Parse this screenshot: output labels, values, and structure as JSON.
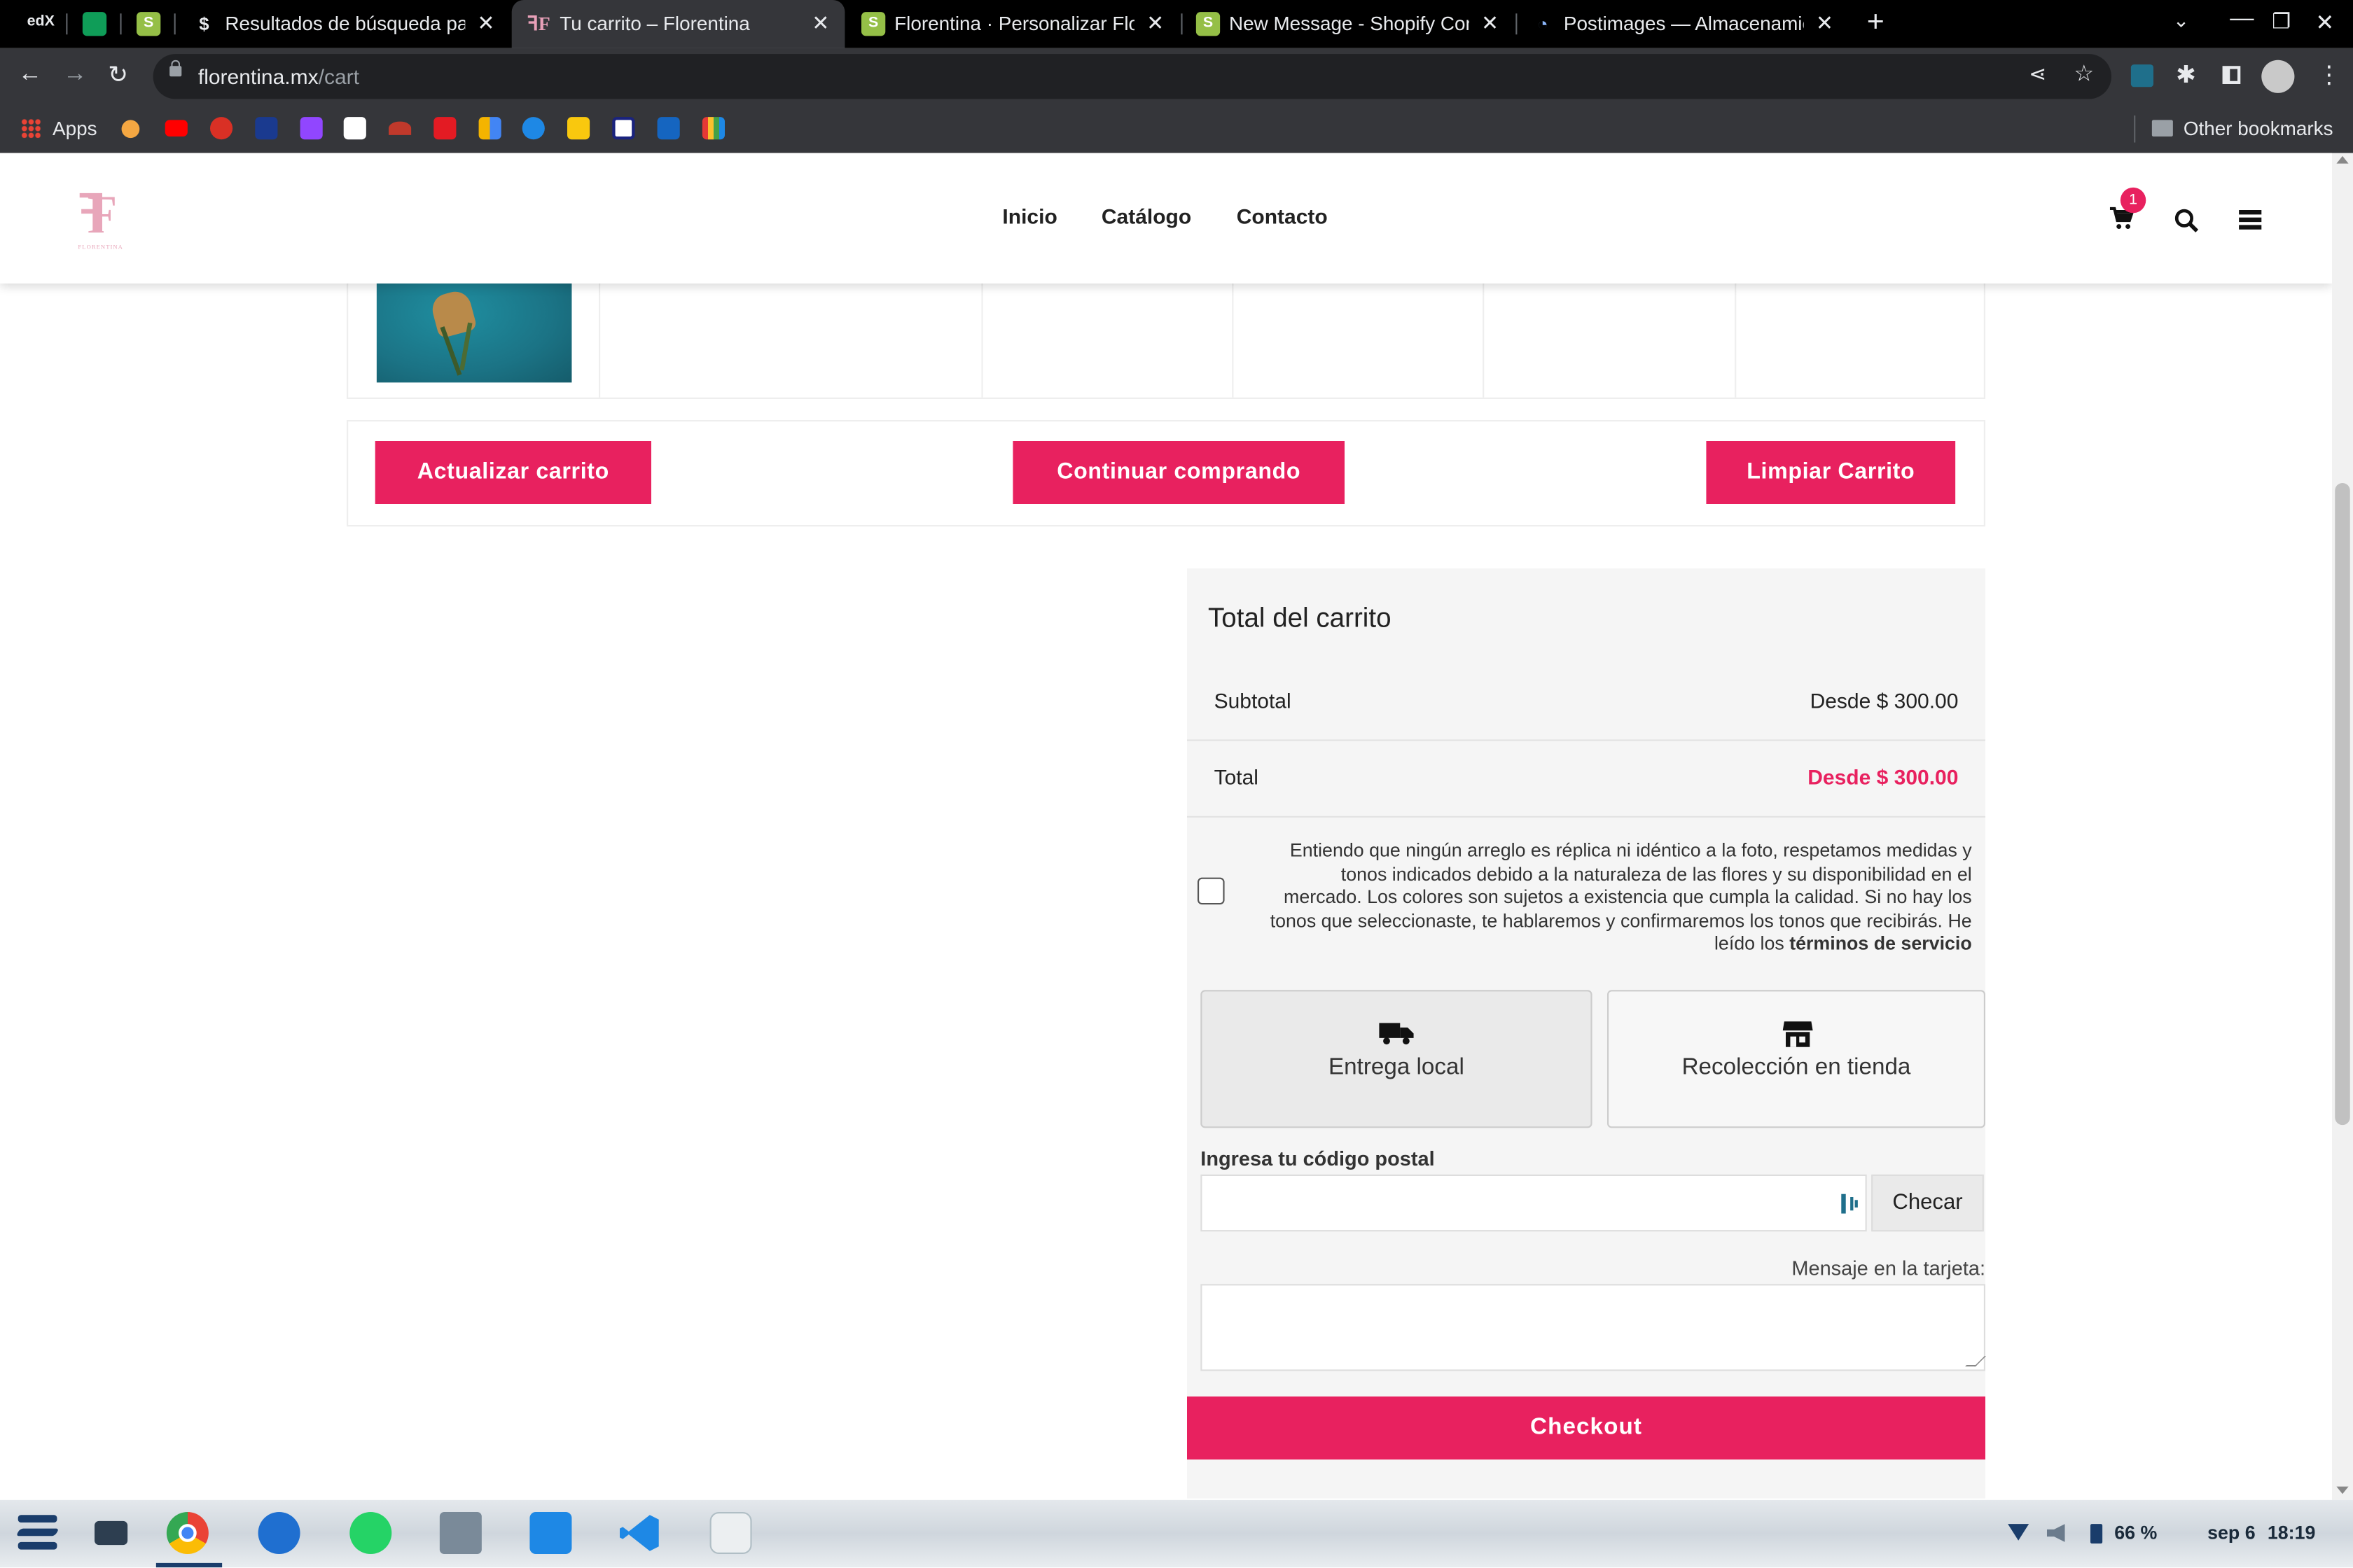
{
  "browser": {
    "tabs": [
      {
        "title": "Resultados de búsqueda pa",
        "favicon": "$"
      },
      {
        "title": "Tu carrito – Florentina",
        "favicon": "FF",
        "active": true
      },
      {
        "title": "Florentina · Personalizar Flos",
        "favicon": "shopify"
      },
      {
        "title": "New Message - Shopify Con",
        "favicon": "shopify"
      },
      {
        "title": "Postimages — Almacenamie",
        "favicon": "postimages"
      }
    ],
    "pinned_tab_label": "edX",
    "url_host": "florentina.mx",
    "url_path": "/cart",
    "bookmarks_apps_label": "Apps",
    "other_bookmarks_label": "Other bookmarks"
  },
  "site": {
    "logo_text": "FLORENTINA",
    "nav": [
      "Inicio",
      "Catálogo",
      "Contacto"
    ],
    "cart_count": "1"
  },
  "cart": {
    "update_button": "Actualizar carrito",
    "continue_button": "Continuar comprando",
    "clear_button": "Limpiar Carrito"
  },
  "totals": {
    "heading": "Total del carrito",
    "subtotal_label": "Subtotal",
    "subtotal_value": "Desde $ 300.00",
    "total_label": "Total",
    "total_value": "Desde $ 300.00",
    "disclaimer_line1": "Entiendo que ningún arreglo es réplica ni idéntico a la foto, respetamos medidas y",
    "disclaimer_line2": "tonos indicados debido a la naturaleza de las flores y su disponibilidad en el",
    "disclaimer_line3": "mercado. Los colores son sujetos a existencia que cumpla la calidad. Si no hay los",
    "disclaimer_line4": "tonos que seleccionaste, te hablaremos y confirmaremos los tonos que recibirás. He",
    "disclaimer_line5_prefix": "leído los ",
    "disclaimer_link": "términos de servicio",
    "delivery_option": "Entrega local",
    "pickup_option": "Recolección en tienda",
    "postal_label": "Ingresa tu código postal",
    "postal_value": "",
    "check_button": "Checar",
    "message_label": "Mensaje en la tarjeta:",
    "message_value": "",
    "checkout_button": "Checkout"
  },
  "taskbar": {
    "battery": "66 %",
    "date": "sep 6",
    "time": "18:19"
  },
  "colors": {
    "accent": "#e8215f",
    "chrome_dark": "#35363a"
  }
}
